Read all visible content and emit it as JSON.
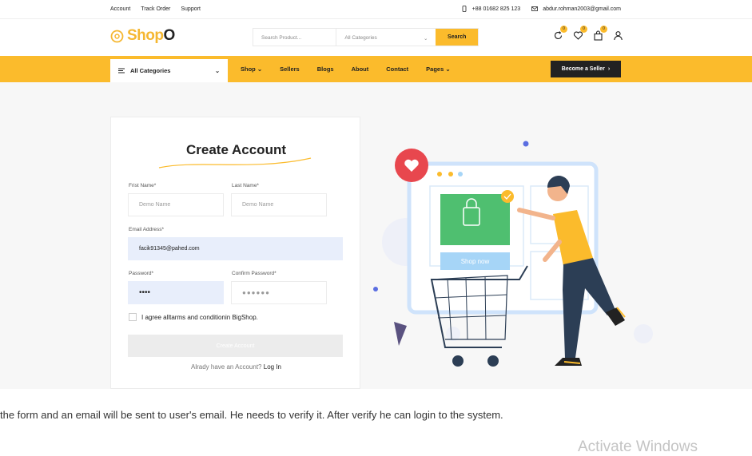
{
  "topbar": {
    "links": [
      "Account",
      "Track Order",
      "Support"
    ],
    "phone": "+88 01682 825 123",
    "email": "abdur.rohman2003@gmail.com"
  },
  "header": {
    "logo": {
      "prefix": "Shop",
      "suffix": "O"
    },
    "search": {
      "placeholder": "Search Product...",
      "category": "All Categories",
      "button": "Search"
    },
    "badges": {
      "compare": "0",
      "wishlist": "0",
      "cart": "0"
    }
  },
  "nav": {
    "all_categories": "All Categories",
    "links": [
      "Shop",
      "Sellers",
      "Blogs",
      "About",
      "Contact",
      "Pages"
    ],
    "become_seller": "Become a Seller"
  },
  "form": {
    "title": "Create Account",
    "first_name": {
      "label": "Frist Name*",
      "placeholder": "Demo Name"
    },
    "last_name": {
      "label": "Last Name*",
      "placeholder": "Demo Name"
    },
    "email": {
      "label": "Email Address*",
      "value": "facik91345@pahed.com"
    },
    "password": {
      "label": "Password*",
      "value": "••••"
    },
    "confirm": {
      "label": "Confirm Password*",
      "placeholder": "●●●●●●"
    },
    "agree": "I agree alltarms and conditionin BigShop.",
    "submit": "Create Account",
    "login_prompt": "Alrady have an Account?",
    "login_link": "Log In"
  },
  "illustration": {
    "button": "Shop now"
  },
  "caption": "the form and an email will be sent to user's email. He needs to verify it. After verify he can login to the system.",
  "watermark": "Activate Windows",
  "colors": {
    "accent": "#fbbb2c",
    "dark": "#222222"
  }
}
